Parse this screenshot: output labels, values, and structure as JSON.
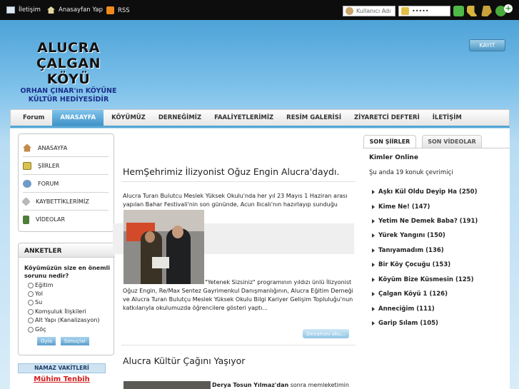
{
  "topbar": {
    "links": [
      {
        "label": "İletişim",
        "icon": "mail-icon"
      },
      {
        "label": "Anasayfan Yap",
        "icon": "home-icon"
      },
      {
        "label": "RSS",
        "icon": "rss-icon"
      }
    ],
    "username_placeholder": "Kullanıcı Adı",
    "password_mask": "•••••"
  },
  "logo": {
    "line1": "ALUCRA",
    "line2": "ÇALGAN KÖYÜ",
    "line3": "ORHAN ÇINAR'ın KÖYÜNE",
    "line4": "KÜLTÜR HEDİYESİDİR"
  },
  "register_label": "KAYIT",
  "nav": [
    "Forum",
    "ANASAYFA",
    "KÖYÜMÜZ",
    "DERNEĞİMİZ",
    "FAALİYETLERİMİZ",
    "RESİM GALERİSİ",
    "ZİYARETCİ DEFTERİ",
    "İLETİŞİM"
  ],
  "left_menu": [
    "ANASAYFA",
    "ŞİİRLER",
    "FORUM",
    "KAYBETTİKLERİMİZ",
    "VİDEOLAR"
  ],
  "poll": {
    "title": "ANKETLER",
    "question": "Köyümüzün size en önemli sorunu nedir?",
    "options": [
      "Eğitim",
      "Yol",
      "Su",
      "Komşuluk İlişkileri",
      "Alt Yapı (Kanalizasyon)",
      "Göç"
    ],
    "vote_label": "Oyla",
    "results_label": "Sonuçlar"
  },
  "namaz": {
    "title": "NAMAZ VAKİTLERİ",
    "notice": "Mühim Tenbih"
  },
  "articles": [
    {
      "title": "HemŞehrimiz İlizyonist Oğuz Engin Alucra'daydı.",
      "intro": "Alucra Turan Bulutcu Meslek Yüksek Okulu'nda her yıl 23 Mayıs 1 Haziran arası yapılan Bahar Festivali'nin son gününde, Acun Ilıcalı'nın hazırlayıp sunduğu",
      "body_line1": "\"Yetenek Sizsiniz\" programının yıldızı ünlü İlizyonist",
      "body_rest": "Oğuz Engin, Re/Max Sentez Gayrimenkul Danışmanlığının, Alucra Eğitim Derneği ve Alucra Turan Bulutçu Meslek Yüksek Okulu Bilgi Kariyer Gelişim Topluluğu'nun katkılarıyla okulumuzda öğrencilere gösteri yaptı...",
      "more_label": "Devamını oku..."
    },
    {
      "title": "Alucra Kültür Çağını Yaşıyor",
      "intro_bold": "Derya Tosun Yılmaz'dan",
      "intro": " sonra memleketimin"
    }
  ],
  "right": {
    "tab_active": "SON ŞİİRLER",
    "tab_inactive": "SON VİDEOLAR",
    "online_title": "Kimler Online",
    "online_text": "Şu anda 19 konuk çevrimiçi",
    "poems": [
      {
        "title": "Aşkı Kül Oldu Deyip Ha",
        "count": "(250)"
      },
      {
        "title": "Kime Ne!",
        "count": "(147)"
      },
      {
        "title": "Yetim Ne Demek Baba?",
        "count": "(191)"
      },
      {
        "title": "Yürek Yangını",
        "count": "(150)"
      },
      {
        "title": "Tanıyamadım",
        "count": "(136)"
      },
      {
        "title": "Bir Köy Çocuğu",
        "count": "(153)"
      },
      {
        "title": "Köyüm Bize Küsmesin",
        "count": "(125)"
      },
      {
        "title": "Çalgan Köyü 1",
        "count": "(126)"
      },
      {
        "title": "Anneciğim",
        "count": "(111)"
      },
      {
        "title": "Garip Sılam",
        "count": "(105)"
      }
    ]
  }
}
